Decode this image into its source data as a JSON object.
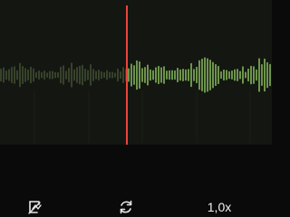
{
  "player": {
    "skip_silence_icon": "skip-silence-icon",
    "loop_icon": "loop-icon",
    "speed_label": "1,0x"
  },
  "colors": {
    "background": "#0a0a0a",
    "waveform_panel": "#141612",
    "played_wave": "#4a5a38",
    "unplayed_wave": "#9bd96a",
    "playhead": "#e8453c"
  }
}
